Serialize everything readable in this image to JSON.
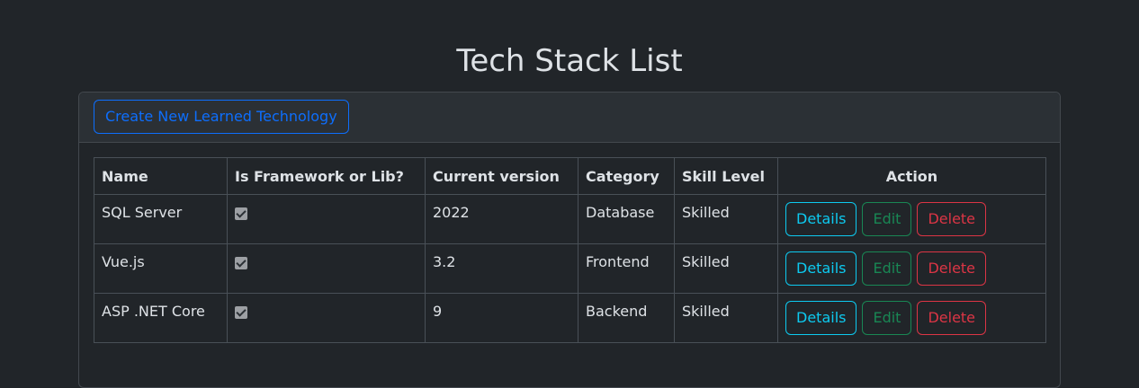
{
  "page": {
    "title": "Tech Stack List"
  },
  "header": {
    "create_label": "Create New Learned Technology"
  },
  "table": {
    "columns": [
      "Name",
      "Is Framework or Lib?",
      "Current version",
      "Category",
      "Skill Level",
      "Action"
    ],
    "rows": [
      {
        "name": "SQL Server",
        "is_framework": true,
        "version": "2022",
        "category": "Database",
        "skill": "Skilled"
      },
      {
        "name": "Vue.js",
        "is_framework": true,
        "version": "3.2",
        "category": "Frontend",
        "skill": "Skilled"
      },
      {
        "name": "ASP .NET Core",
        "is_framework": true,
        "version": "9",
        "category": "Backend",
        "skill": "Skilled"
      }
    ]
  },
  "actions": {
    "details_label": "Details",
    "edit_label": "Edit",
    "delete_label": "Delete"
  },
  "colors": {
    "primary": "#0d6efd",
    "info": "#0dcaf0",
    "success": "#198754",
    "danger": "#dc3545",
    "background": "#212529"
  }
}
